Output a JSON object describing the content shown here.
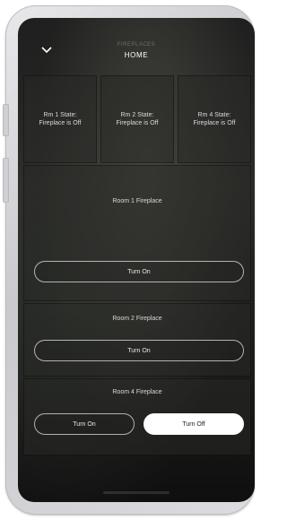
{
  "header": {
    "section": "FIREPLACES",
    "title": "HOME"
  },
  "states": [
    {
      "line1": "Rm 1 State:",
      "line2": "Fireplace is Off"
    },
    {
      "line1": "Rm 2 State:",
      "line2": "Fireplace is Off"
    },
    {
      "line1": "Rm 4 State:",
      "line2": "Fireplace is Off"
    }
  ],
  "room1": {
    "label": "Room 1 Fireplace",
    "on_label": "Turn On"
  },
  "room2": {
    "label": "Room 2 Fireplace",
    "on_label": "Turn On"
  },
  "room4": {
    "label": "Room 4 Fireplace",
    "on_label": "Turn On",
    "off_label": "Turn Off"
  },
  "icons": {
    "back": "chevron-down-icon"
  }
}
